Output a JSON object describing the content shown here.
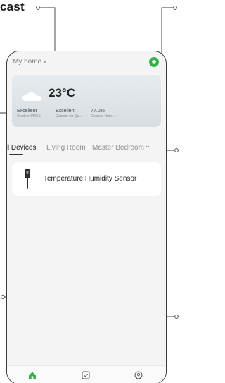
{
  "caption": {
    "title_fragment": "cast"
  },
  "header": {
    "home_label": "My home",
    "home_caret": "▾",
    "add_glyph": "+"
  },
  "weather": {
    "temperature": "23°C",
    "metrics": [
      {
        "value": "Excellent",
        "label": "Outdoor PM2.5"
      },
      {
        "value": "Excellent",
        "label": "Outdoor Air Qu..."
      },
      {
        "value": "77.0%",
        "label": "Outdoor Humi..."
      }
    ]
  },
  "tabs": [
    {
      "label": "All Devices",
      "active": true
    },
    {
      "label": "Living Room",
      "active": false
    },
    {
      "label": "Master Bedroom",
      "active": false
    }
  ],
  "more_glyph": "···",
  "devices": [
    {
      "name": "Temperature Humidity Sensor",
      "icon": "sensor-probe-icon"
    }
  ],
  "nav": [
    {
      "icon": "home-icon",
      "active": true
    },
    {
      "icon": "scene-check-icon",
      "active": false
    },
    {
      "icon": "profile-icon",
      "active": false
    }
  ],
  "colors": {
    "accent": "#35b04a",
    "text": "#1b1b1b",
    "muted": "#8e8e8e",
    "card": "#ffffff",
    "background": "#f4f4f4"
  }
}
